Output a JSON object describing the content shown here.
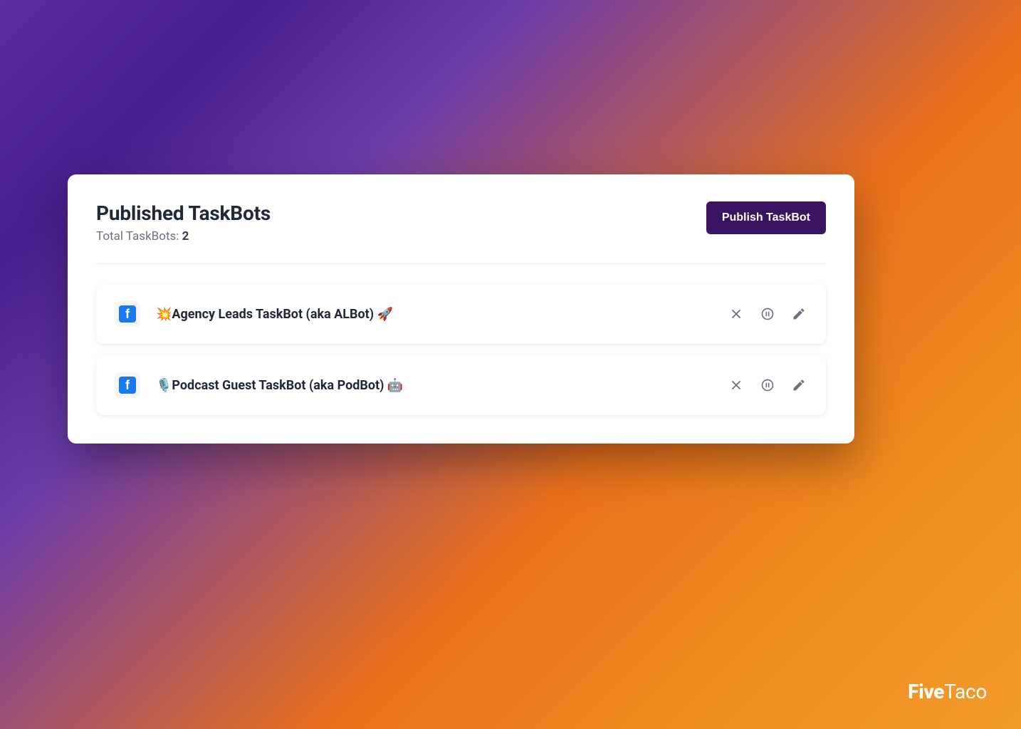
{
  "header": {
    "title": "Published TaskBots",
    "subtitle_label": "Total TaskBots: ",
    "count": "2",
    "publish_button": "Publish TaskBot"
  },
  "taskbots": [
    {
      "icon": "f",
      "name": "💥Agency Leads TaskBot (aka ALBot) 🚀"
    },
    {
      "icon": "f",
      "name": "🎙️Podcast Guest TaskBot (aka PodBot) 🤖"
    }
  ],
  "watermark": {
    "bold": "Five",
    "light": "Taco"
  }
}
